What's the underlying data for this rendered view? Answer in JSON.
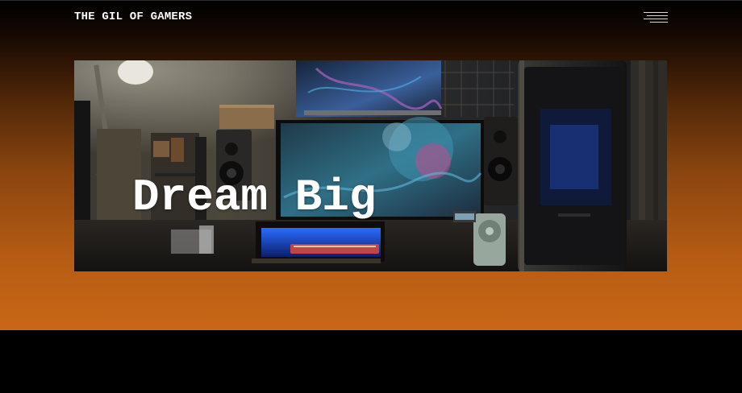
{
  "header": {
    "brand": "THE GIL OF GAMERS",
    "menu_icon": "hamburger-menu-icon"
  },
  "hero": {
    "title": "Dream Big",
    "image": "gaming-desk-setup-photo",
    "colors": {
      "title_text": "#ffffff"
    }
  },
  "theme": {
    "gradient_top": "#000000",
    "gradient_bottom": "#c86716",
    "footer_band": "#000000"
  }
}
